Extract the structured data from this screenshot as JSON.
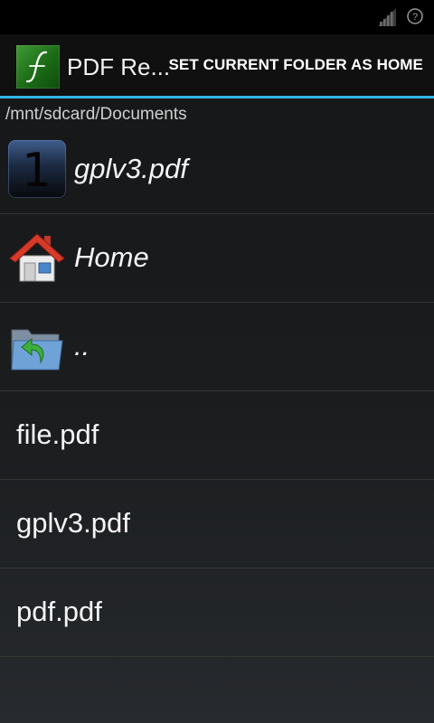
{
  "status_bar": {
    "signal_icon": "signal-strength-icon",
    "help_icon": "question-circle-icon"
  },
  "action_bar": {
    "app_icon": "pdf-reader-logo-icon",
    "title": "PDF Re...",
    "action_label": "SET CURRENT FOLDER AS HOME",
    "accent_color": "#33b5e5"
  },
  "path": "/mnt/sdcard/Documents",
  "list": {
    "recent": {
      "icon_text": "1",
      "label": "gplv3.pdf"
    },
    "home": {
      "icon": "house-icon",
      "label": "Home"
    },
    "up": {
      "icon": "folder-up-icon",
      "label": ".."
    },
    "files": [
      {
        "label": "file.pdf"
      },
      {
        "label": "gplv3.pdf"
      },
      {
        "label": "pdf.pdf"
      }
    ]
  }
}
